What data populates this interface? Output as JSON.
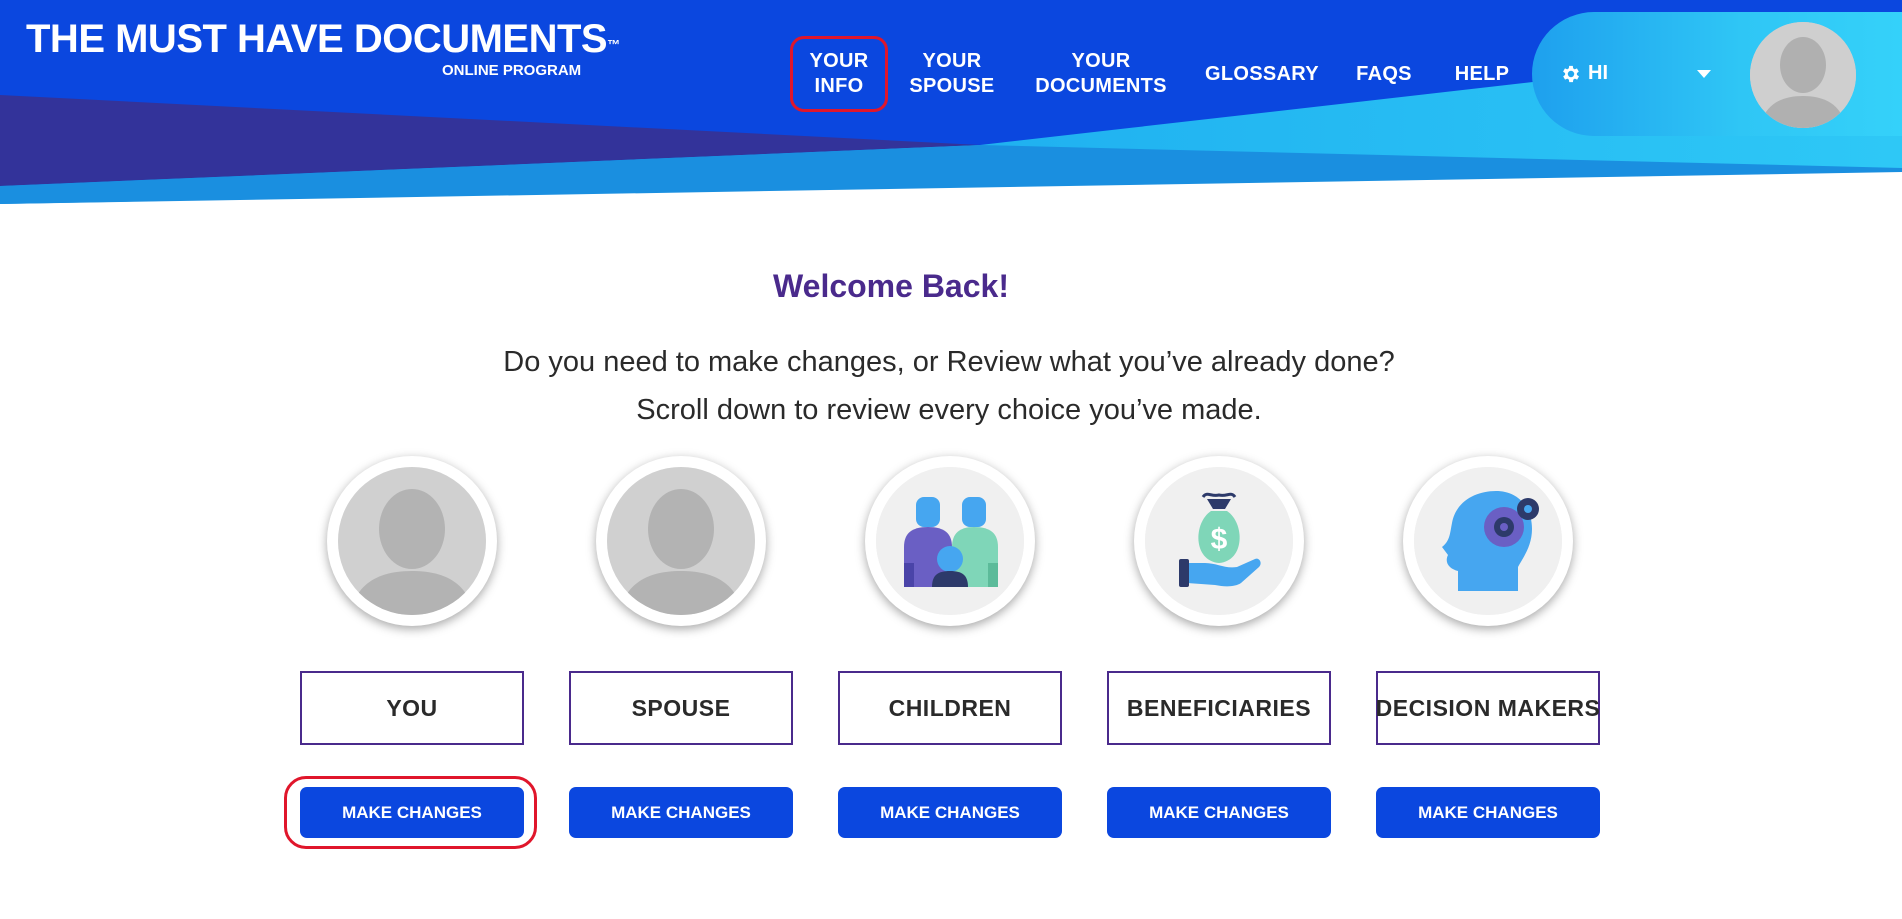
{
  "header": {
    "logo_title": "THE MUST HAVE DOCUMENTS",
    "logo_tm": "™",
    "logo_subtitle": "ONLINE PROGRAM",
    "nav": [
      {
        "label": "YOUR\nINFO",
        "highlighted": true
      },
      {
        "label": "YOUR\nSPOUSE"
      },
      {
        "label": "YOUR\nDOCUMENTS"
      },
      {
        "label": "GLOSSARY"
      },
      {
        "label": "FAQS"
      },
      {
        "label": "HELP"
      }
    ],
    "user_greeting": "HI"
  },
  "main": {
    "welcome": "Welcome Back!",
    "intro_line1": "Do you need to make changes, or Review what you’ve already done?",
    "intro_line2": "Scroll down to review every choice you’ve made.",
    "sections": [
      {
        "label": "YOU",
        "button": "MAKE CHANGES",
        "icon": "person-placeholder-icon",
        "highlighted": true
      },
      {
        "label": "SPOUSE",
        "button": "MAKE CHANGES",
        "icon": "person-placeholder-icon"
      },
      {
        "label": "CHILDREN",
        "button": "MAKE CHANGES",
        "icon": "family-icon"
      },
      {
        "label": "BENEFICIARIES",
        "button": "MAKE CHANGES",
        "icon": "money-bag-hand-icon"
      },
      {
        "label": "DECISION MAKERS",
        "button": "MAKE CHANGES",
        "icon": "head-gears-icon"
      }
    ]
  },
  "colors": {
    "header_blue": "#0b47df",
    "header_dark": "#33339a",
    "accent_cyan": "#2fc6f5",
    "title_purple": "#4a2a8c",
    "button_blue": "#0b47df",
    "highlight_red": "#e0162b"
  }
}
